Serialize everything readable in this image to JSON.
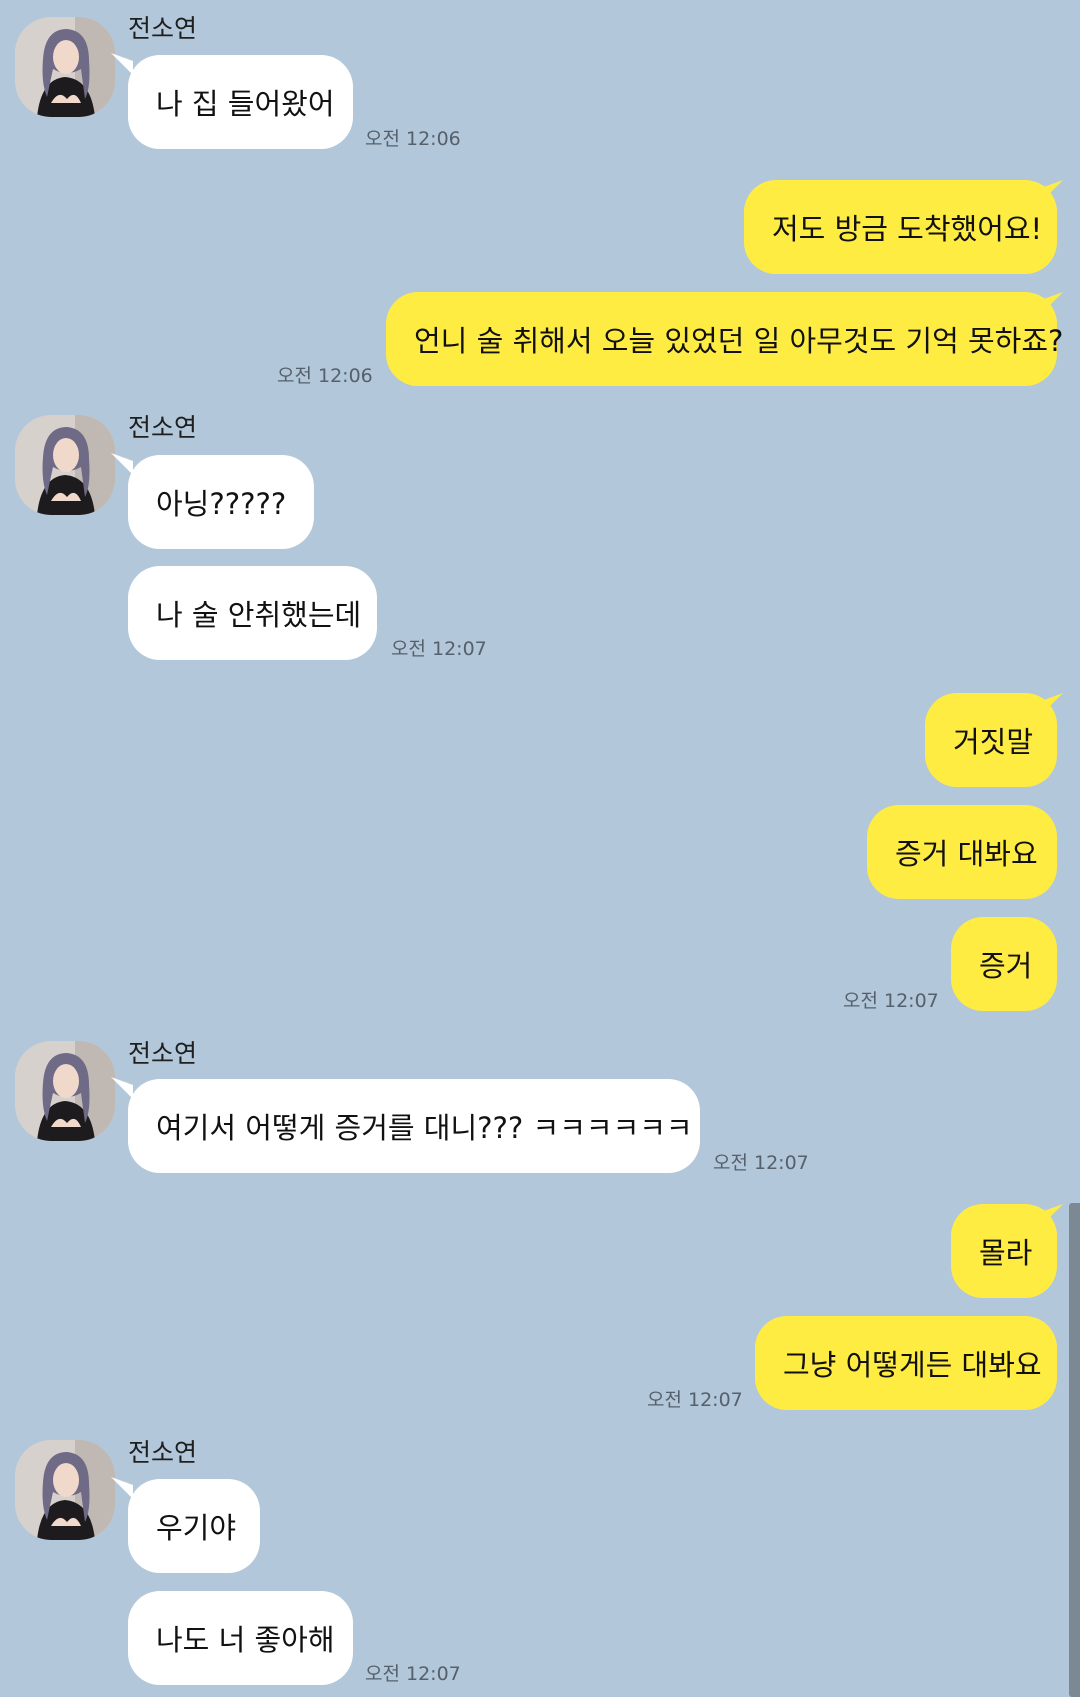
{
  "sender_name": "전소연",
  "messages": [
    {
      "text": "나 집 들어왔어"
    },
    {
      "text": "저도 방금 도착했어요!"
    },
    {
      "text": "언니 술 취해서 오늘 있었던 일 아무것도 기억 못하죠?"
    },
    {
      "text": "아닝?????"
    },
    {
      "text": "나 술 안취했는데"
    },
    {
      "text": "거짓말"
    },
    {
      "text": "증거 대봐요"
    },
    {
      "text": "증거"
    },
    {
      "text": "여기서 어떻게 증거를 대니??? ㅋㅋㅋㅋㅋㅋ"
    },
    {
      "text": "몰라"
    },
    {
      "text": "그냥 어떻게든 대봐요"
    },
    {
      "text": "우기야"
    },
    {
      "text": "나도 너 좋아해"
    }
  ],
  "timestamps": [
    "오전 12:06",
    "오전 12:06",
    "오전 12:07",
    "오전 12:07",
    "오전 12:07",
    "오전 12:07",
    "오전 12:07"
  ],
  "colors": {
    "background": "#b2c7da",
    "incoming_bubble": "#ffffff",
    "outgoing_bubble": "#ffec42",
    "timestamp": "#55606b"
  }
}
